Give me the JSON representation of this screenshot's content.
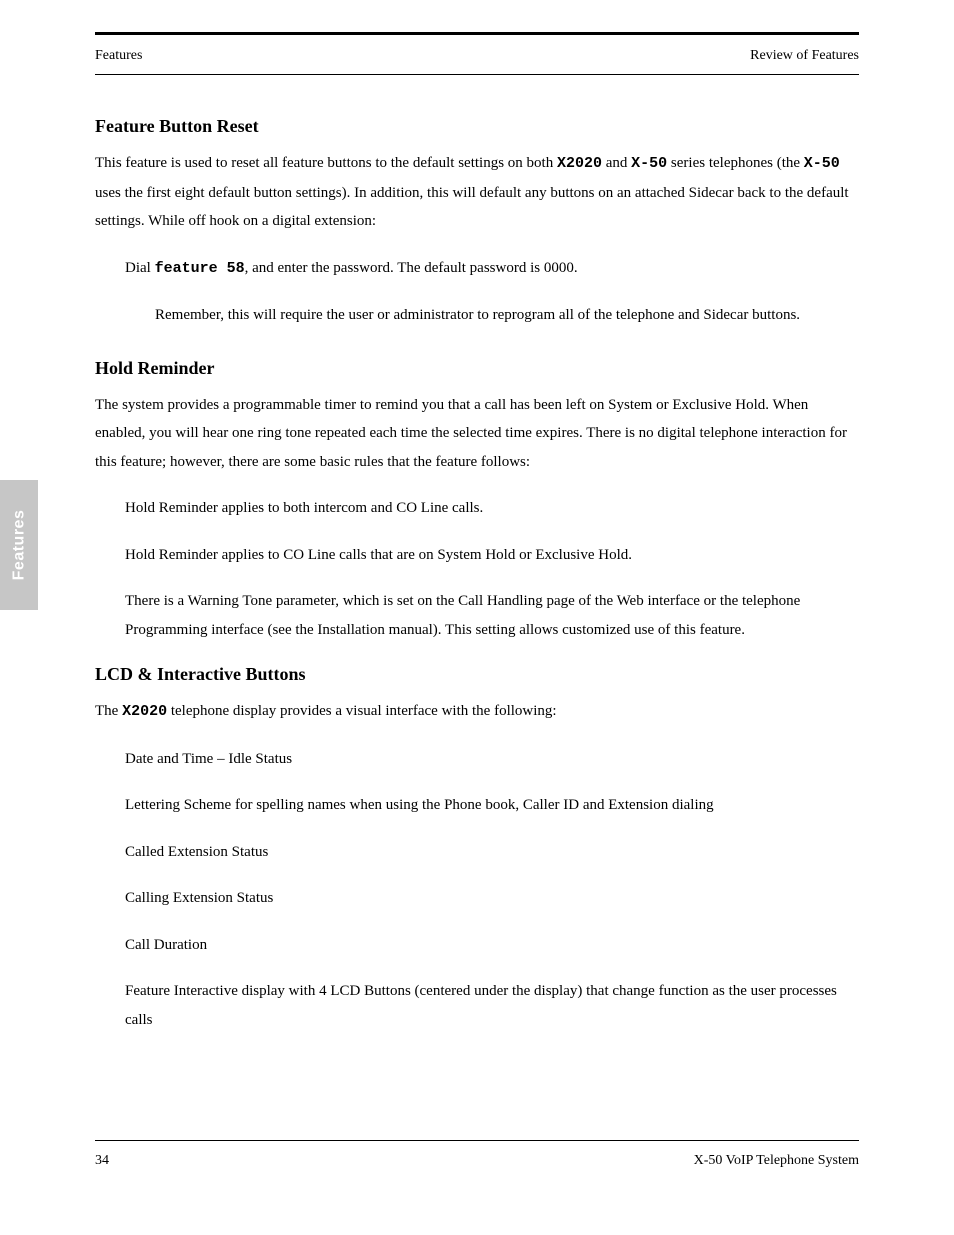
{
  "header": {
    "left": "Features",
    "right": "Review of Features"
  },
  "sections": {
    "fbr": {
      "title": "Feature Button Reset",
      "p1_prefix": "This feature is used to reset all feature buttons to the default settings on both ",
      "p1_model_a": "X2020",
      "p1_mid": " and ",
      "p1_model_b": "X-50",
      "p1_tail": " series telephones (the ",
      "p1_model_c": "X-50",
      "p1_tail2": " uses the first eight default button settings). In addition, this will default any buttons on an attached Sidecar back to the default settings. While off hook on a digital extension:",
      "step_prefix": "Dial ",
      "step_code": "feature 58",
      "step_tail": ", and enter the password. The default password is 0000.",
      "caution": "Remember, this will require the user or administrator to reprogram all of the telephone and Sidecar buttons."
    },
    "hr": {
      "title": "Hold Reminder",
      "p1": "The system provides a programmable timer to remind you that a call has been left on System or Exclusive Hold. When enabled, you will hear one ring tone repeated each time the selected time expires. There is no digital telephone interaction for this feature; however, there are some basic rules that the feature follows:",
      "b1": "Hold Reminder applies to both intercom and CO Line calls.",
      "b2": "Hold Reminder applies to CO Line calls that are on System Hold or Exclusive Hold.",
      "b3": "There is a Warning Tone parameter, which is set on the Call Handling page of the Web interface or the telephone Programming interface (see the Installation manual). This setting allows customized use of this feature."
    },
    "lcd": {
      "title": "LCD & Interactive Buttons",
      "p1_pre": "The ",
      "p1_model": "X2020",
      "p1_post": " telephone display provides a visual interface with the following:",
      "b1": "Date and Time – Idle Status",
      "b2": "Lettering Scheme for spelling names when using the Phone book, Caller ID and Extension dialing",
      "b3": "Called Extension Status",
      "b4": "Calling Extension Status",
      "b5": "Call Duration",
      "b6": "Feature Interactive display with 4 LCD Buttons (centered under the display) that change function as the user processes calls"
    }
  },
  "sidetab": "Features",
  "footer": {
    "page": "34",
    "title": "X-50 VoIP Telephone System"
  }
}
